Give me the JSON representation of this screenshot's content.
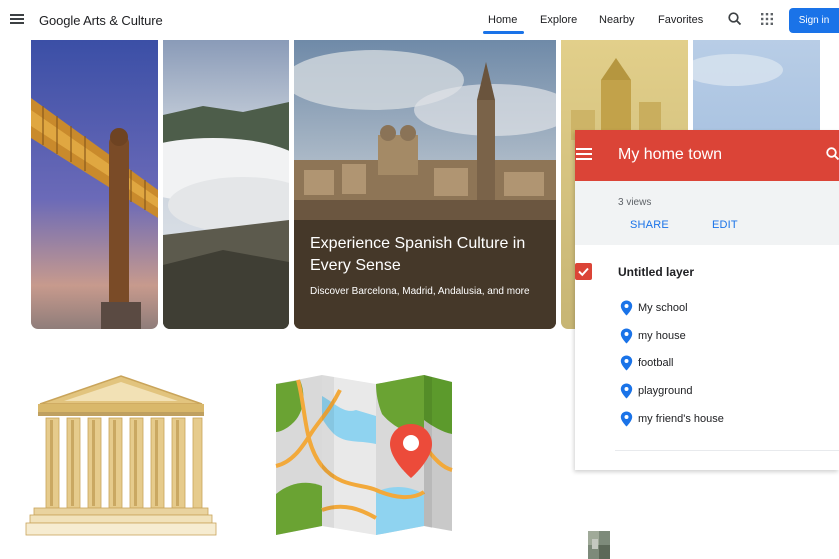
{
  "header": {
    "logo": "Google Arts & Culture",
    "nav": [
      {
        "label": "Home",
        "active": true
      },
      {
        "label": "Explore",
        "active": false
      },
      {
        "label": "Nearby",
        "active": false
      },
      {
        "label": "Favorites",
        "active": false
      }
    ],
    "signin_label": "Sign in",
    "icons": [
      "menu-icon",
      "search-icon",
      "apps-grid-icon"
    ]
  },
  "featured": {
    "title": "Experience Spanish Culture in Every Sense",
    "subtitle": "Discover Barcelona, Madrid, Andalusia, and more"
  },
  "map_panel": {
    "title": "My home town",
    "views": "3 views",
    "share_label": "SHARE",
    "edit_label": "EDIT",
    "layer_title": "Untitled layer",
    "layer_checked": true,
    "places": [
      "My school",
      "my house",
      "football",
      "playground",
      "my friend's house"
    ],
    "header_color": "#db4437",
    "pin_color": "#1a73e8"
  },
  "colors": {
    "accent": "#1a73e8",
    "panel_red": "#db4437"
  }
}
